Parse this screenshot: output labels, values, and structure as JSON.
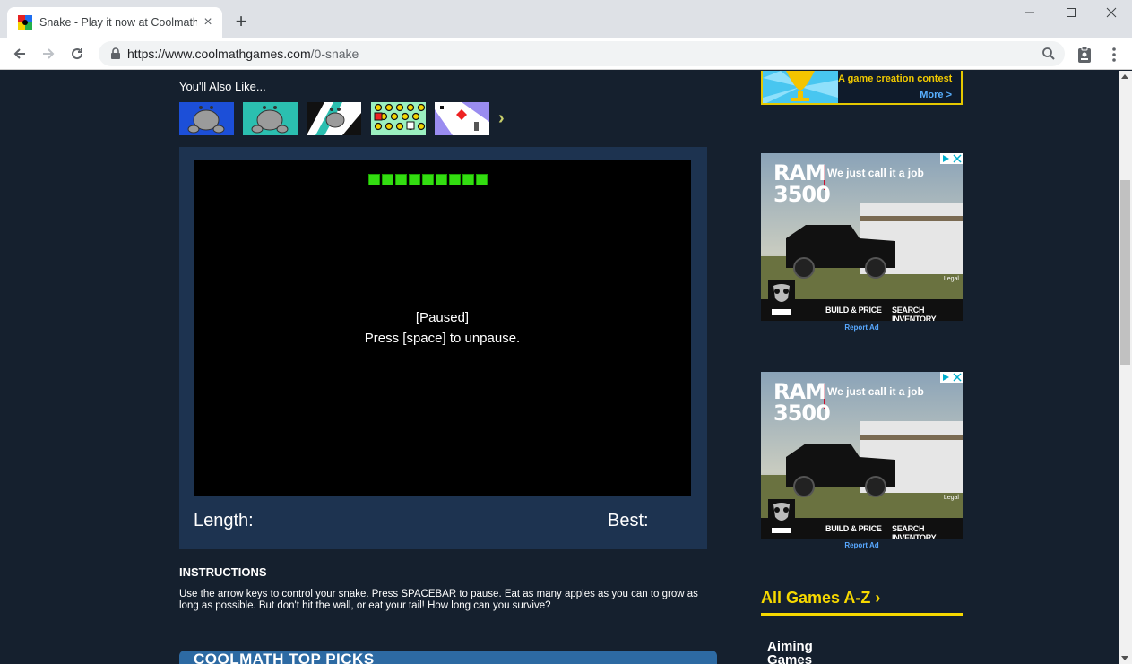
{
  "browser": {
    "tab_title": "Snake - Play it now at Coolmath-",
    "tab_close": "×",
    "new_tab": "+",
    "url_host": "https://www.coolmathgames.com",
    "url_path": "/0-snake",
    "win_minimize": "—",
    "win_maximize": "☐",
    "win_close": "✕",
    "back": "←",
    "forward": "→",
    "reload": "↻"
  },
  "page": {
    "also_like": "You'll Also Like...",
    "also_like_next": "›",
    "game": {
      "paused_line1": "[Paused]",
      "paused_line2": "Press [space] to unpause.",
      "length_label": "Length:",
      "best_label": "Best:",
      "snake_segments": 9
    },
    "instructions_title": "INSTRUCTIONS",
    "instructions_text": "Use the arrow keys to control your snake. Press SPACEBAR to pause. Eat as many apples as you can to grow as long as possible. But don't hit the wall, or eat your tail! How long can you survive?",
    "top_picks": "COOLMATH TOP PICKS"
  },
  "sidebar": {
    "contest_text": "A game creation contest",
    "contest_more": "More >",
    "ads": [
      {
        "logo": "RAM 3500",
        "tagline": "We just call it a job",
        "legal": "Legal",
        "build": "BUILD & PRICE",
        "search": "SEARCH INVENTORY",
        "report": "Report Ad"
      },
      {
        "logo": "RAM 3500",
        "tagline": "We just call it a job",
        "legal": "Legal",
        "build": "BUILD & PRICE",
        "search": "SEARCH INVENTORY",
        "report": "Report Ad"
      }
    ],
    "all_games": "All Games A-Z ›",
    "aiming": "Aiming Games"
  }
}
